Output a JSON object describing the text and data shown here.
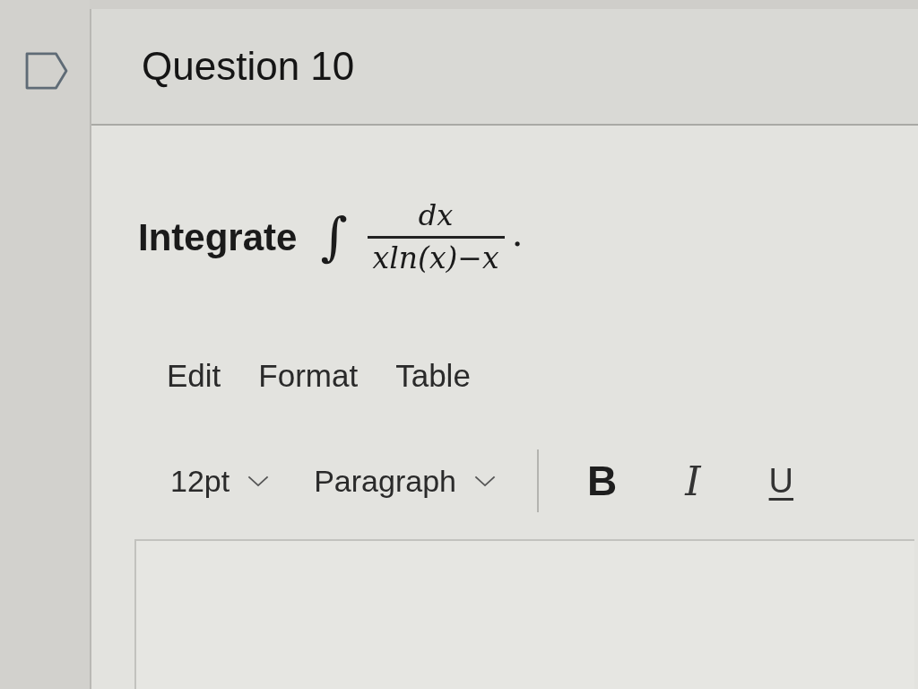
{
  "question": {
    "title": "Question 10",
    "flagged": false,
    "prompt": "Integrate",
    "formula": {
      "integral": "∫",
      "numerator": "dx",
      "denominator": "xln(x)−x",
      "end": "."
    }
  },
  "editor": {
    "menu": [
      "Edit",
      "Format",
      "Table"
    ],
    "toolbar": [
      {
        "kind": "dropdown",
        "label": "12pt"
      },
      {
        "kind": "dropdown",
        "label": "Paragraph"
      },
      {
        "kind": "separator"
      },
      {
        "kind": "bold",
        "label": "B"
      },
      {
        "kind": "italic",
        "label": "I"
      },
      {
        "kind": "underline",
        "label": "U"
      }
    ]
  }
}
